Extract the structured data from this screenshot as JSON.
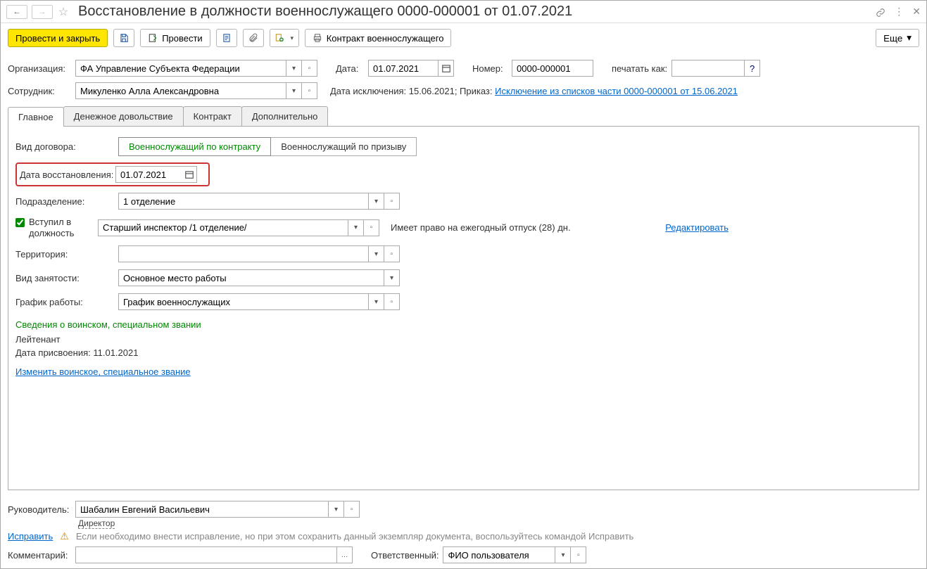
{
  "title": "Восстановление в должности военнослужащего 0000-000001 от 01.07.2021",
  "toolbar": {
    "post_and_close": "Провести и закрыть",
    "post": "Провести",
    "contract": "Контракт военнослужащего",
    "more": "Еще"
  },
  "header": {
    "org_label": "Организация:",
    "org_value": "ФА Управление Субъекта Федерации",
    "date_label": "Дата:",
    "date_value": "01.07.2021",
    "number_label": "Номер:",
    "number_value": "0000-000001",
    "print_as_label": "печатать как:",
    "print_as_value": "",
    "employee_label": "Сотрудник:",
    "employee_value": "Микуленко Алла Александровна",
    "exclusion_prefix": "Дата исключения: 15.06.2021; Приказ: ",
    "exclusion_link": "Исключение из списков части 0000-000001 от 15.06.2021"
  },
  "tabs": {
    "main": "Главное",
    "money": "Денежное довольствие",
    "contract": "Контракт",
    "extra": "Дополнительно"
  },
  "main_tab": {
    "contract_type_label": "Вид договора:",
    "contract_type_opt1": "Военнослужащий по контракту",
    "contract_type_opt2": "Военнослужащий по призыву",
    "restore_date_label": "Дата восстановления:",
    "restore_date_value": "01.07.2021",
    "department_label": "Подразделение:",
    "department_value": "1 отделение",
    "entered_position_cb_label": "Вступил в должность",
    "entered_position_value": "Старший инспектор /1 отделение/",
    "vacation_text": "Имеет право на ежегодный отпуск (28) дн.",
    "edit_link": "Редактировать",
    "territory_label": "Территория:",
    "territory_value": "",
    "employment_label": "Вид занятости:",
    "employment_value": "Основное место работы",
    "schedule_label": "График работы:",
    "schedule_value": "График военнослужащих",
    "rank_section_title": "Сведения о воинском, специальном звании",
    "rank_value": "Лейтенант",
    "rank_date": "Дата присвоения: 11.01.2021",
    "change_rank_link": "Изменить воинское, специальное звание"
  },
  "footer": {
    "manager_label": "Руководитель:",
    "manager_value": "Шабалин Евгений Васильевич",
    "manager_role": "Директор",
    "correct_link": "Исправить",
    "correct_hint": "Если необходимо внести исправление, но при этом сохранить данный экземпляр документа, воспользуйтесь командой Исправить",
    "comment_label": "Комментарий:",
    "comment_value": "",
    "responsible_label": "Ответственный:",
    "responsible_value": "ФИО пользователя"
  }
}
